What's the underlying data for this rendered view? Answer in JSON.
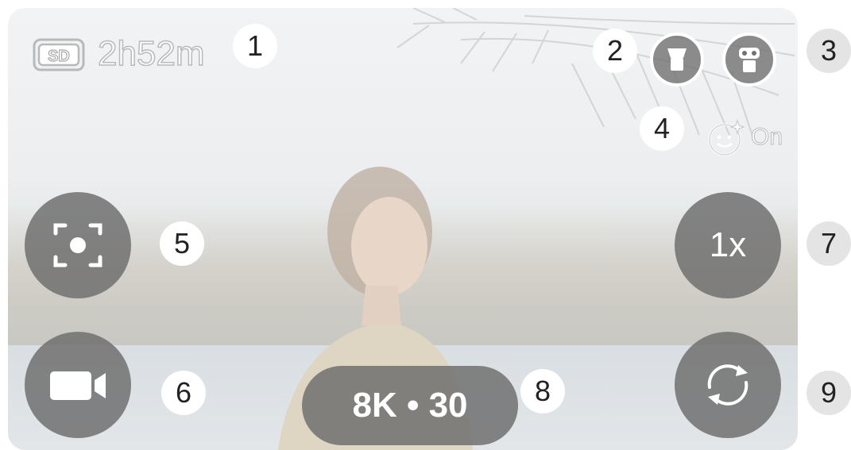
{
  "storage": {
    "badge": "SD",
    "remaining": "2h52m"
  },
  "callouts": {
    "c1": "1",
    "c2": "2",
    "c3": "3",
    "c4": "4",
    "c5": "5",
    "c6": "6",
    "c7": "7",
    "c8": "8",
    "c9": "9"
  },
  "beauty": {
    "status": "On",
    "icon": "face-retouch-icon"
  },
  "zoom": {
    "label": "1x"
  },
  "resolution": {
    "label": "8K • 30"
  },
  "buttons": {
    "lens_single": "single-lens-icon",
    "lens_dual": "dual-lens-icon",
    "focus": "focus-frame-icon",
    "mode": "video-camera-icon",
    "flip": "switch-camera-icon"
  },
  "colors": {
    "button_fill": "#707070",
    "callout_bg": "#ffffff",
    "callout_bg_outside": "#e4e4e4"
  }
}
